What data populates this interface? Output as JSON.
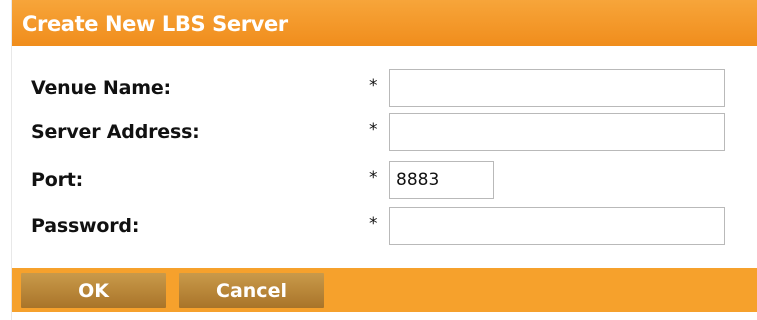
{
  "dialog": {
    "title": "Create New LBS Server"
  },
  "form": {
    "fields": [
      {
        "label": "Venue Name:",
        "required_mark": "*",
        "value": ""
      },
      {
        "label": "Server Address:",
        "required_mark": "*",
        "value": ""
      },
      {
        "label": "Port:",
        "required_mark": "*",
        "value": "8883"
      },
      {
        "label": "Password:",
        "required_mark": "*",
        "value": ""
      }
    ]
  },
  "buttons": {
    "ok_label": "OK",
    "cancel_label": "Cancel"
  },
  "colors": {
    "title_bar": "#f29420",
    "footer_bar": "#f6a12c",
    "button": "#b8853a"
  }
}
